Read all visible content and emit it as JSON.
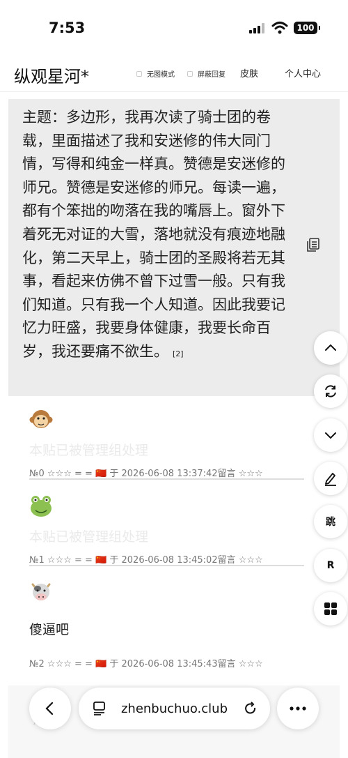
{
  "status": {
    "time": "7:53",
    "battery": "100"
  },
  "header": {
    "site_title": "纵观星河*",
    "option_no_image": "无图模式",
    "option_block_reply": "屏蔽回复",
    "skin": "皮肤",
    "profile": "个人中心"
  },
  "post": {
    "text": "主题：多边形，我再次读了骑士团的卷载，里面描述了我和安迷修的伟大同门情，写得和纯金一样真。赞德是安迷修的师兄。赞德是安迷修的师兄。每读一遍，都有个笨拙的吻落在我的嘴唇上。窗外下着死无对证的大雪，落地就没有痕迹地融化，第二天早上，骑士团的圣殿将若无其事，看起来仿佛不曾下过雪一般。只有我们知道。只有我一个人知道。因此我要记忆力旺盛，我要身体健康，我要长命百岁，我还要痛不欲生。",
    "cite": "[2]"
  },
  "comments": [
    {
      "avatar": "monkey-avatar",
      "text": "本贴已被管理组处理",
      "meta": "№0 ☆☆☆ = = 🇨🇳 于 2026-06-08 13:37:42留言 ☆☆☆"
    },
    {
      "avatar": "frog-avatar",
      "text": "本贴已被管理组处理",
      "meta": "№1 ☆☆☆ = = 🇨🇳 于 2026-06-08 13:45:02留言 ☆☆☆"
    },
    {
      "avatar": "cow-avatar",
      "text": "傻逼吧",
      "meta": "№2 ☆☆☆ = = 🇨🇳 于 2026-06-08 13:45:43留言 ☆☆☆"
    }
  ],
  "fabs": {
    "jump": "跳",
    "reply": "R"
  },
  "browser": {
    "url": "zhenbuchuo.club",
    "ghost": "№ = ="
  },
  "colors": {
    "post_bg": "#ececec",
    "hidden_text": "#eaeaea"
  }
}
